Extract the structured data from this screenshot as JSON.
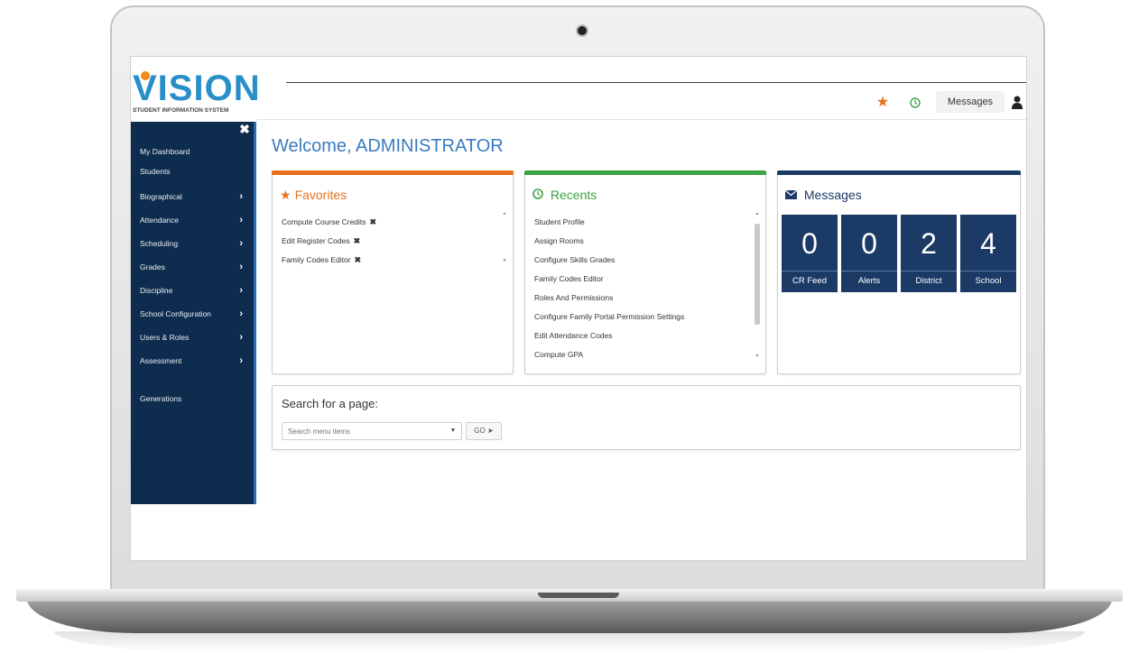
{
  "app": {
    "logo_text": "VISION",
    "logo_subtitle": "STUDENT INFORMATION SYSTEM"
  },
  "header": {
    "messages_label": "Messages",
    "favorites_icon": "star-icon",
    "recents_icon": "clock-icon",
    "user_icon": "user-icon"
  },
  "sidebar": {
    "close_icon": "close-icon",
    "items": [
      {
        "label": "My Dashboard",
        "has_arrow": false
      },
      {
        "label": "Students",
        "has_arrow": false
      },
      {
        "label": "Biographical",
        "has_arrow": true
      },
      {
        "label": "Attendance",
        "has_arrow": true
      },
      {
        "label": "Scheduling",
        "has_arrow": true
      },
      {
        "label": "Grades",
        "has_arrow": true
      },
      {
        "label": "Discipline",
        "has_arrow": true
      },
      {
        "label": "School Configuration",
        "has_arrow": true
      },
      {
        "label": "Users & Roles",
        "has_arrow": true
      },
      {
        "label": "Assessment",
        "has_arrow": true
      },
      {
        "label": "Generations",
        "has_arrow": false
      }
    ]
  },
  "main": {
    "welcome": "Welcome, ADMINISTRATOR",
    "favorites": {
      "title": "Favorites",
      "items": [
        "Compute Course Credits",
        "Edit Register Codes",
        "Family Codes Editor"
      ]
    },
    "recents": {
      "title": "Recents",
      "items": [
        "Student Profile",
        "Assign Rooms",
        "Configure Skills Grades",
        "Family Codes Editor",
        "Roles And Permissions",
        "Configure Family Portal Permission Settings",
        "Edit Attendance Codes",
        "Compute GPA"
      ]
    },
    "messages": {
      "title": "Messages",
      "tiles": [
        {
          "count": "0",
          "label": "CR Feed"
        },
        {
          "count": "0",
          "label": "Alerts"
        },
        {
          "count": "2",
          "label": "District"
        },
        {
          "count": "4",
          "label": "School"
        }
      ]
    },
    "search": {
      "title": "Search for a page:",
      "placeholder": "Search menu items",
      "go_label": "GO"
    }
  },
  "colors": {
    "sidebar_bg": "#0e2c4e",
    "favorites_accent": "#e8701c",
    "recents_accent": "#3aa341",
    "messages_accent": "#1b3a66",
    "welcome_text": "#3b7bbf"
  }
}
